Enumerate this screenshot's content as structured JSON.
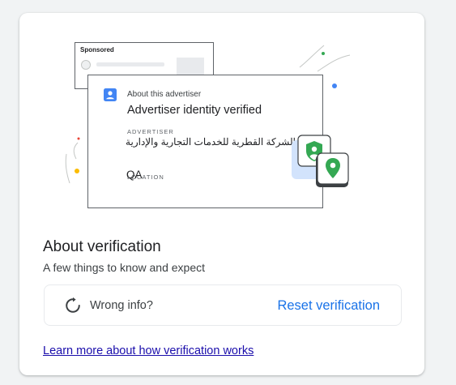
{
  "illustration": {
    "sponsored_label": "Sponsored",
    "about_label": "About this advertiser",
    "verified_title": "Advertiser identity verified",
    "advertiser_label": "ADVERTISER",
    "advertiser_name": "الشركة القطرية للخدمات التجارية والإدارية",
    "location_label": "LOCATION",
    "location_value": "QA",
    "icons": [
      "person-icon",
      "shield-person-icon",
      "location-pin-icon"
    ]
  },
  "verification": {
    "title": "About verification",
    "subtitle": "A few things to know and expect",
    "wrong_info": {
      "icon": "reset-icon",
      "label": "Wrong info?",
      "action": "Reset verification"
    },
    "learn_more": "Learn more about how verification works"
  },
  "colors": {
    "accent": "#1a73e8",
    "link": "#1a0dab",
    "green": "#34a853",
    "red": "#ea4335",
    "yellow": "#fbbc04",
    "blue_icon": "#4285f4"
  }
}
